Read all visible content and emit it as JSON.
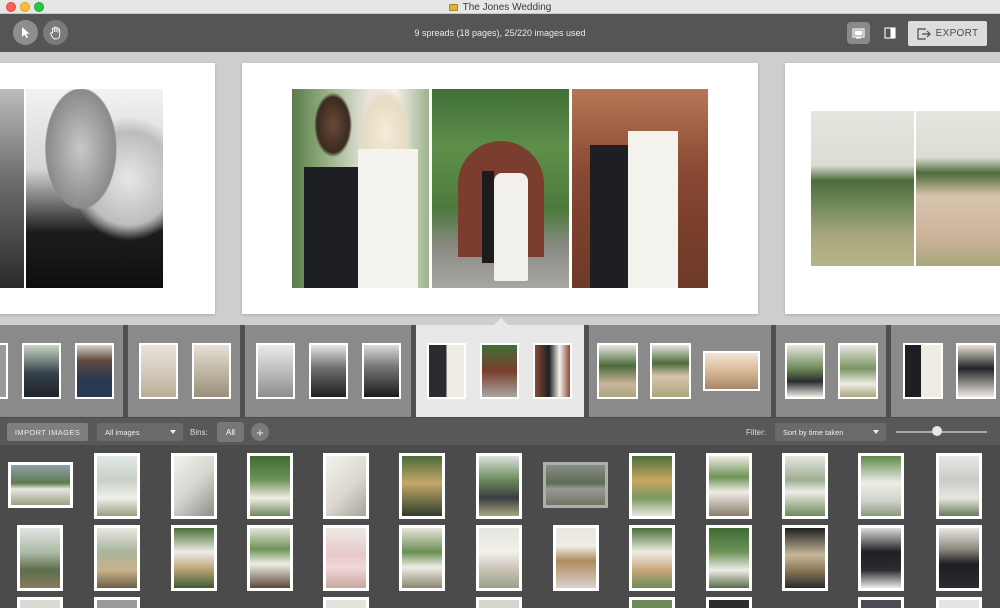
{
  "window": {
    "title": "The Jones Wedding"
  },
  "toolbar": {
    "status": "9 spreads (18 pages), 25/220 images used",
    "export_label": "EXPORT",
    "tools": [
      "select-tool",
      "pan-tool"
    ],
    "views": [
      "single-view",
      "panel-view"
    ]
  },
  "library_bar": {
    "import_label": "IMPORT IMAGES",
    "images_filter": "All images",
    "bins_label": "Bins:",
    "bin_all": "All",
    "add_bin": "+",
    "filter_label": "Filter:",
    "sort_value": "Sort by time taken"
  },
  "colors": {
    "accent": "#dcdcdc",
    "canvas_bg": "#cecece",
    "active_spread": "#e8e8e8"
  }
}
